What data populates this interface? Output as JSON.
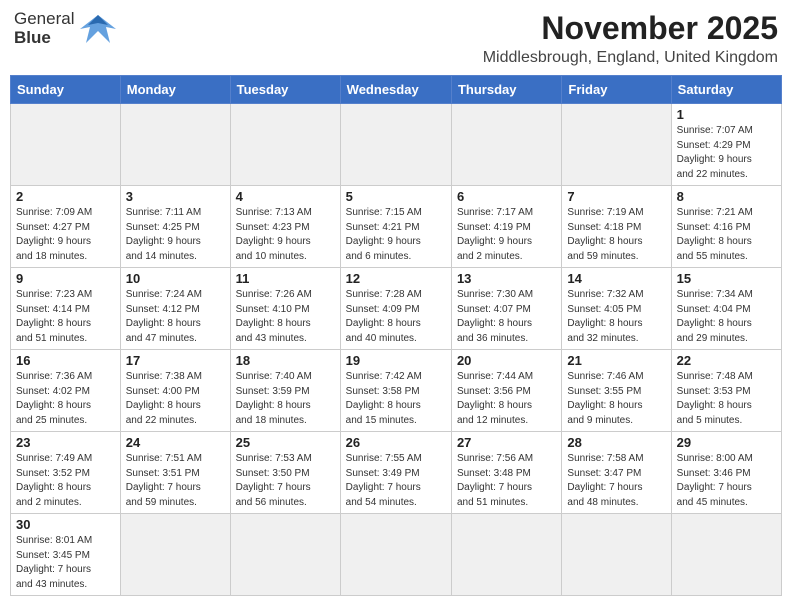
{
  "header": {
    "logo_line1": "General",
    "logo_line2": "Blue",
    "month_title": "November 2025",
    "location": "Middlesbrough, England, United Kingdom"
  },
  "weekdays": [
    "Sunday",
    "Monday",
    "Tuesday",
    "Wednesday",
    "Thursday",
    "Friday",
    "Saturday"
  ],
  "weeks": [
    [
      {
        "num": "",
        "info": "",
        "empty": true
      },
      {
        "num": "",
        "info": "",
        "empty": true
      },
      {
        "num": "",
        "info": "",
        "empty": true
      },
      {
        "num": "",
        "info": "",
        "empty": true
      },
      {
        "num": "",
        "info": "",
        "empty": true
      },
      {
        "num": "",
        "info": "",
        "empty": true
      },
      {
        "num": "1",
        "info": "Sunrise: 7:07 AM\nSunset: 4:29 PM\nDaylight: 9 hours\nand 22 minutes."
      }
    ],
    [
      {
        "num": "2",
        "info": "Sunrise: 7:09 AM\nSunset: 4:27 PM\nDaylight: 9 hours\nand 18 minutes."
      },
      {
        "num": "3",
        "info": "Sunrise: 7:11 AM\nSunset: 4:25 PM\nDaylight: 9 hours\nand 14 minutes."
      },
      {
        "num": "4",
        "info": "Sunrise: 7:13 AM\nSunset: 4:23 PM\nDaylight: 9 hours\nand 10 minutes."
      },
      {
        "num": "5",
        "info": "Sunrise: 7:15 AM\nSunset: 4:21 PM\nDaylight: 9 hours\nand 6 minutes."
      },
      {
        "num": "6",
        "info": "Sunrise: 7:17 AM\nSunset: 4:19 PM\nDaylight: 9 hours\nand 2 minutes."
      },
      {
        "num": "7",
        "info": "Sunrise: 7:19 AM\nSunset: 4:18 PM\nDaylight: 8 hours\nand 59 minutes."
      },
      {
        "num": "8",
        "info": "Sunrise: 7:21 AM\nSunset: 4:16 PM\nDaylight: 8 hours\nand 55 minutes."
      }
    ],
    [
      {
        "num": "9",
        "info": "Sunrise: 7:23 AM\nSunset: 4:14 PM\nDaylight: 8 hours\nand 51 minutes."
      },
      {
        "num": "10",
        "info": "Sunrise: 7:24 AM\nSunset: 4:12 PM\nDaylight: 8 hours\nand 47 minutes."
      },
      {
        "num": "11",
        "info": "Sunrise: 7:26 AM\nSunset: 4:10 PM\nDaylight: 8 hours\nand 43 minutes."
      },
      {
        "num": "12",
        "info": "Sunrise: 7:28 AM\nSunset: 4:09 PM\nDaylight: 8 hours\nand 40 minutes."
      },
      {
        "num": "13",
        "info": "Sunrise: 7:30 AM\nSunset: 4:07 PM\nDaylight: 8 hours\nand 36 minutes."
      },
      {
        "num": "14",
        "info": "Sunrise: 7:32 AM\nSunset: 4:05 PM\nDaylight: 8 hours\nand 32 minutes."
      },
      {
        "num": "15",
        "info": "Sunrise: 7:34 AM\nSunset: 4:04 PM\nDaylight: 8 hours\nand 29 minutes."
      }
    ],
    [
      {
        "num": "16",
        "info": "Sunrise: 7:36 AM\nSunset: 4:02 PM\nDaylight: 8 hours\nand 25 minutes."
      },
      {
        "num": "17",
        "info": "Sunrise: 7:38 AM\nSunset: 4:00 PM\nDaylight: 8 hours\nand 22 minutes."
      },
      {
        "num": "18",
        "info": "Sunrise: 7:40 AM\nSunset: 3:59 PM\nDaylight: 8 hours\nand 18 minutes."
      },
      {
        "num": "19",
        "info": "Sunrise: 7:42 AM\nSunset: 3:58 PM\nDaylight: 8 hours\nand 15 minutes."
      },
      {
        "num": "20",
        "info": "Sunrise: 7:44 AM\nSunset: 3:56 PM\nDaylight: 8 hours\nand 12 minutes."
      },
      {
        "num": "21",
        "info": "Sunrise: 7:46 AM\nSunset: 3:55 PM\nDaylight: 8 hours\nand 9 minutes."
      },
      {
        "num": "22",
        "info": "Sunrise: 7:48 AM\nSunset: 3:53 PM\nDaylight: 8 hours\nand 5 minutes."
      }
    ],
    [
      {
        "num": "23",
        "info": "Sunrise: 7:49 AM\nSunset: 3:52 PM\nDaylight: 8 hours\nand 2 minutes."
      },
      {
        "num": "24",
        "info": "Sunrise: 7:51 AM\nSunset: 3:51 PM\nDaylight: 7 hours\nand 59 minutes."
      },
      {
        "num": "25",
        "info": "Sunrise: 7:53 AM\nSunset: 3:50 PM\nDaylight: 7 hours\nand 56 minutes."
      },
      {
        "num": "26",
        "info": "Sunrise: 7:55 AM\nSunset: 3:49 PM\nDaylight: 7 hours\nand 54 minutes."
      },
      {
        "num": "27",
        "info": "Sunrise: 7:56 AM\nSunset: 3:48 PM\nDaylight: 7 hours\nand 51 minutes."
      },
      {
        "num": "28",
        "info": "Sunrise: 7:58 AM\nSunset: 3:47 PM\nDaylight: 7 hours\nand 48 minutes."
      },
      {
        "num": "29",
        "info": "Sunrise: 8:00 AM\nSunset: 3:46 PM\nDaylight: 7 hours\nand 45 minutes."
      }
    ],
    [
      {
        "num": "30",
        "info": "Sunrise: 8:01 AM\nSunset: 3:45 PM\nDaylight: 7 hours\nand 43 minutes."
      },
      {
        "num": "",
        "info": "",
        "empty": true
      },
      {
        "num": "",
        "info": "",
        "empty": true
      },
      {
        "num": "",
        "info": "",
        "empty": true
      },
      {
        "num": "",
        "info": "",
        "empty": true
      },
      {
        "num": "",
        "info": "",
        "empty": true
      },
      {
        "num": "",
        "info": "",
        "empty": true
      }
    ]
  ]
}
